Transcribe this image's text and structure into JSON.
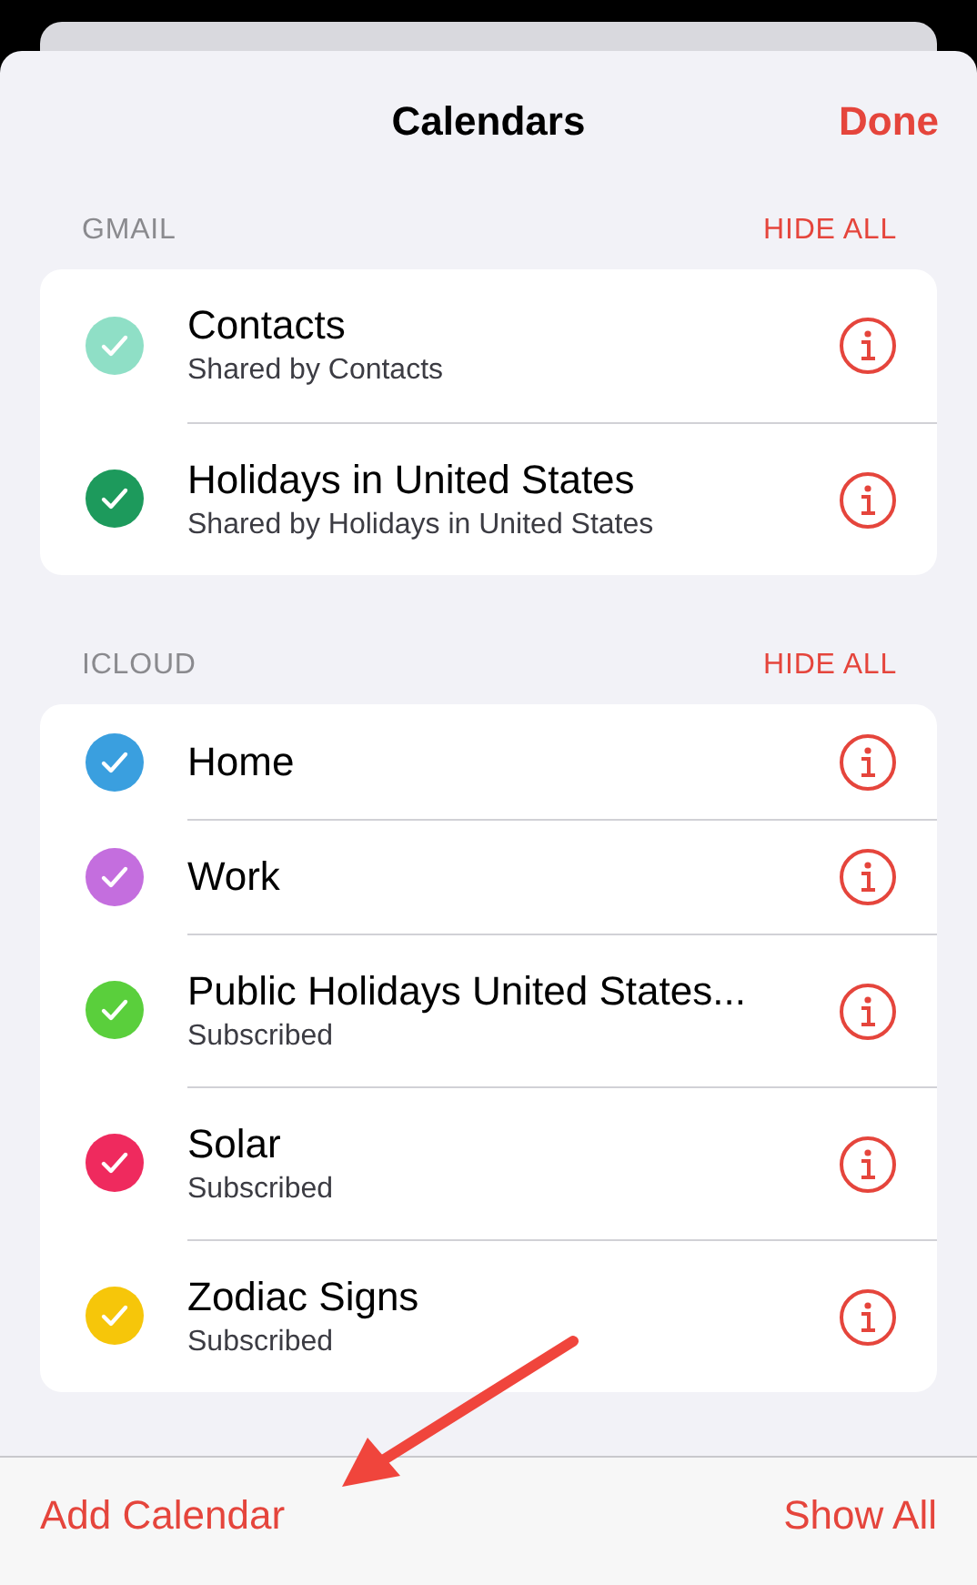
{
  "header": {
    "title": "Calendars",
    "done": "Done"
  },
  "sections": [
    {
      "name": "GMAIL",
      "action": "HIDE ALL",
      "calendars": [
        {
          "name": "Contacts",
          "subtitle": "Shared by Contacts",
          "checked": true,
          "color": "#8fdfc6"
        },
        {
          "name": "Holidays in United States",
          "subtitle": "Shared by Holidays in United States",
          "checked": true,
          "color": "#1d9a5c"
        }
      ]
    },
    {
      "name": "ICLOUD",
      "action": "HIDE ALL",
      "calendars": [
        {
          "name": "Home",
          "checked": true,
          "color": "#3a9fdf"
        },
        {
          "name": "Work",
          "checked": true,
          "color": "#c46ede"
        },
        {
          "name": "Public Holidays United States...",
          "subtitle": "Subscribed",
          "checked": true,
          "color": "#5acf3c"
        },
        {
          "name": "Solar",
          "subtitle": "Subscribed",
          "checked": true,
          "color": "#ef2a5e"
        },
        {
          "name": "Zodiac Signs",
          "subtitle": "Subscribed",
          "checked": true,
          "color": "#f6c60a"
        }
      ]
    }
  ],
  "footer": {
    "add": "Add Calendar",
    "show_all": "Show All"
  }
}
